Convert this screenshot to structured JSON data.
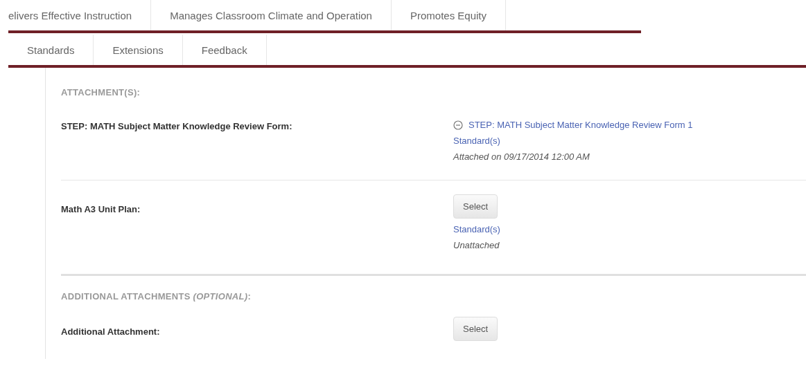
{
  "tab_rows": [
    [
      {
        "label": "elivers Effective Instruction"
      },
      {
        "label": "Manages Classroom Climate and Operation"
      },
      {
        "label": "Promotes Equity"
      }
    ],
    [
      {
        "label": "Standards"
      },
      {
        "label": "Extensions"
      },
      {
        "label": "Feedback"
      }
    ]
  ],
  "sections": [
    {
      "heading": "ATTACHMENT(S):",
      "items": [
        {
          "label": "STEP: MATH Subject Matter Knowledge Review Form:",
          "kind": "attached",
          "file": "STEP: MATH Subject Matter Knowledge Review Form 1",
          "standards_link": "Standard(s)",
          "status": "Attached on 09/17/2014 12:00 AM"
        },
        {
          "label": "Math A3 Unit Plan:",
          "kind": "select",
          "button": "Select",
          "standards_link": "Standard(s)",
          "status": "Unattached"
        }
      ]
    },
    {
      "heading": "ADDITIONAL ATTACHMENTS *(OPTIONAL)*:",
      "items": [
        {
          "label": "Additional Attachment:",
          "kind": "select",
          "button": "Select"
        }
      ]
    }
  ]
}
